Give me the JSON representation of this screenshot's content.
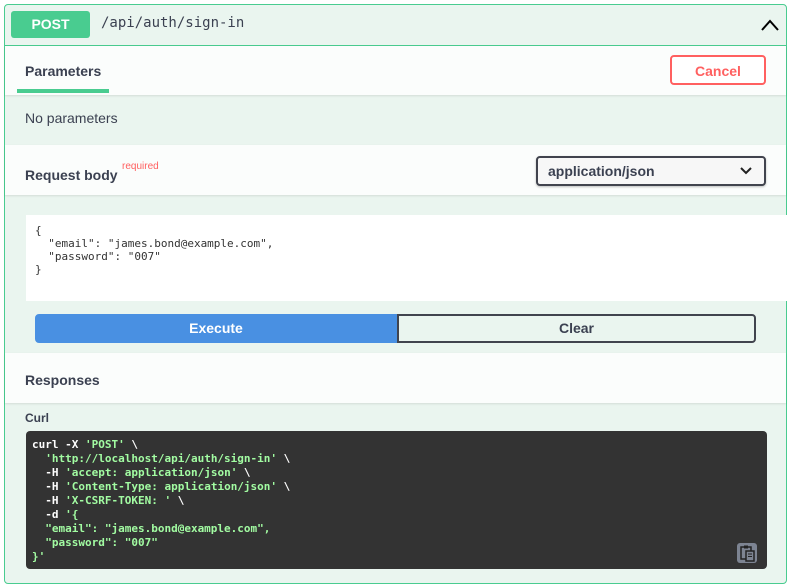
{
  "operation": {
    "method": "POST",
    "path": "/api/auth/sign-in",
    "collapse_icon": "chevron-up-icon"
  },
  "parameters": {
    "tab_label": "Parameters",
    "cancel_label": "Cancel",
    "empty_text": "No parameters"
  },
  "request_body": {
    "title": "Request body",
    "required_label": "required",
    "content_type": "application/json",
    "body_lines": [
      "{",
      "  \"email\": \"james.bond@example.com\",",
      "  \"password\": \"007\"",
      "}"
    ]
  },
  "actions": {
    "execute_label": "Execute",
    "clear_label": "Clear"
  },
  "responses": {
    "title": "Responses",
    "curl_label": "Curl",
    "curl_lines": [
      [
        {
          "t": "curl -X ",
          "s": false
        },
        {
          "t": "'POST'",
          "s": true
        },
        {
          "t": " \\",
          "s": false
        }
      ],
      [
        {
          "t": "  ",
          "s": false
        },
        {
          "t": "'http://localhost/api/auth/sign-in'",
          "s": true
        },
        {
          "t": " \\",
          "s": false
        }
      ],
      [
        {
          "t": "  -H ",
          "s": false
        },
        {
          "t": "'accept: application/json'",
          "s": true
        },
        {
          "t": " \\",
          "s": false
        }
      ],
      [
        {
          "t": "  -H ",
          "s": false
        },
        {
          "t": "'Content-Type: application/json'",
          "s": true
        },
        {
          "t": " \\",
          "s": false
        }
      ],
      [
        {
          "t": "  -H ",
          "s": false
        },
        {
          "t": "'X-CSRF-TOKEN: '",
          "s": true
        },
        {
          "t": " \\",
          "s": false
        }
      ],
      [
        {
          "t": "  -d ",
          "s": false
        },
        {
          "t": "'{",
          "s": true
        }
      ],
      [
        {
          "t": "  \"email\": \"james.bond@example.com\",",
          "s": true
        }
      ],
      [
        {
          "t": "  \"password\": \"007\"",
          "s": true
        }
      ],
      [
        {
          "t": "}'",
          "s": true
        }
      ]
    ],
    "copy_icon": "clipboard-icon"
  },
  "colors": {
    "post_green": "#49cc90",
    "cancel_red": "#ff6060",
    "execute_blue": "#4990e2",
    "code_bg": "#333333"
  }
}
